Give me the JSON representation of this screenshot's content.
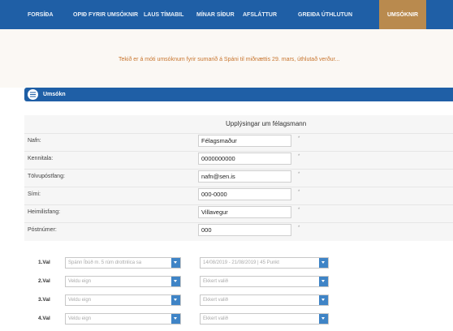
{
  "nav": {
    "items": [
      {
        "label": "FORSÍÐA"
      },
      {
        "label": "OPIÐ FYRIR UMSÓKNIR"
      },
      {
        "label": "LAUS TÍMABIL"
      },
      {
        "label": "MÍNAR SÍÐUR"
      },
      {
        "label": "AFSLÁTTUR"
      },
      {
        "label": "GREIÐA ÚTHLUTUN"
      },
      {
        "label": "UMSÓKNIR"
      }
    ]
  },
  "notice": {
    "text": "Tekið er á móti umsóknum fyrir sumarið á Spáni til miðnættis 29. mars, úthlutað verður..."
  },
  "panel": {
    "title": "Umsókn"
  },
  "form": {
    "title": "Upplýsingar um félagsmann",
    "fields": [
      {
        "label": "Nafn:",
        "value": "Félagsmaður"
      },
      {
        "label": "Kennitala:",
        "value": "0000000000"
      },
      {
        "label": "Tölvupóstfang:",
        "value": "nafn@sen.is"
      },
      {
        "label": "Sími:",
        "value": "000-0000"
      },
      {
        "label": "Heimilisfang:",
        "value": "Villavegur"
      },
      {
        "label": "Póstnúmer:",
        "value": "000"
      }
    ],
    "required_mark": "*"
  },
  "choices": [
    {
      "label": "1.Val",
      "option": "Spánn Íbúð m. 5 rúm drottnlica sa",
      "period": "14/08/2019 - 21/08/2019 | 45 Punkt"
    },
    {
      "label": "2.Val",
      "option": "Veldu eign",
      "period": "Ekkert valið"
    },
    {
      "label": "3.Val",
      "option": "Veldu eign",
      "period": "Ekkert valið"
    },
    {
      "label": "4.Val",
      "option": "Veldu eign",
      "period": "Ekkert valið"
    }
  ],
  "colors": {
    "nav_bg": "#1f5fa6",
    "nav_active": "#b98a4e",
    "notice_text": "#c8752e",
    "select_arrow": "#3f84c6"
  }
}
